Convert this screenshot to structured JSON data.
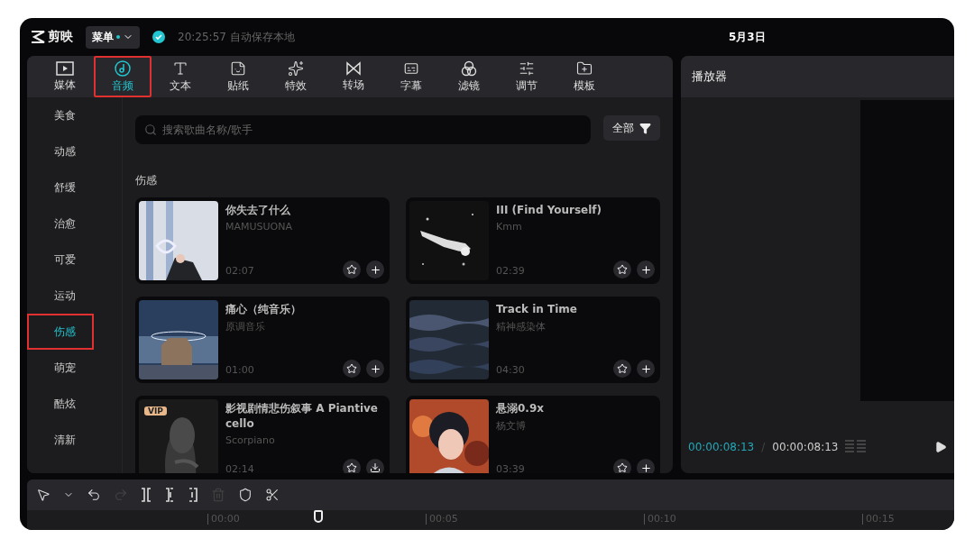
{
  "app": {
    "name": "剪映",
    "menu": "菜单",
    "menu_dot": true,
    "save_status": "20:25:57 自动保存本地",
    "date": "5月3日"
  },
  "tabs": [
    {
      "label": "媒体",
      "selected": false,
      "annotated": false
    },
    {
      "label": "音频",
      "selected": true,
      "annotated": true
    },
    {
      "label": "文本",
      "selected": false,
      "annotated": false
    },
    {
      "label": "贴纸",
      "selected": false,
      "annotated": false
    },
    {
      "label": "特效",
      "selected": false,
      "annotated": false
    },
    {
      "label": "转场",
      "selected": false,
      "annotated": false
    },
    {
      "label": "字幕",
      "selected": false,
      "annotated": false
    },
    {
      "label": "滤镜",
      "selected": false,
      "annotated": false
    },
    {
      "label": "调节",
      "selected": false,
      "annotated": false
    },
    {
      "label": "模板",
      "selected": false,
      "annotated": false
    }
  ],
  "categories": [
    {
      "label": "美食",
      "selected": false,
      "annotated": false
    },
    {
      "label": "动感",
      "selected": false,
      "annotated": false
    },
    {
      "label": "舒缓",
      "selected": false,
      "annotated": false
    },
    {
      "label": "治愈",
      "selected": false,
      "annotated": false
    },
    {
      "label": "可爱",
      "selected": false,
      "annotated": false
    },
    {
      "label": "运动",
      "selected": false,
      "annotated": false
    },
    {
      "label": "伤感",
      "selected": true,
      "annotated": true
    },
    {
      "label": "萌宠",
      "selected": false,
      "annotated": false
    },
    {
      "label": "酷炫",
      "selected": false,
      "annotated": false
    },
    {
      "label": "清新",
      "selected": false,
      "annotated": false
    }
  ],
  "search": {
    "placeholder": "搜索歌曲名称/歌手",
    "filter": "全部"
  },
  "section_title": "伤感",
  "songs": [
    {
      "title": "你失去了什么",
      "artist": "MAMUSUONA",
      "duration": "02:07",
      "kind": "add"
    },
    {
      "title": "III (Find Yourself)",
      "artist": "Kmm",
      "duration": "02:39",
      "kind": "add"
    },
    {
      "title": "痛心（纯音乐）",
      "artist": "原调音乐",
      "duration": "01:00",
      "kind": "add"
    },
    {
      "title": "Track in Time",
      "artist": "精神感染体",
      "duration": "04:30",
      "kind": "add"
    },
    {
      "title": "影视剧情悲伤叙事  A Piantive cello",
      "artist": "Scorpiano",
      "duration": "02:14",
      "kind": "download",
      "badge": "VIP"
    },
    {
      "title": "悬溺0.9x",
      "artist": "杨文博",
      "duration": "03:39",
      "kind": "add"
    }
  ],
  "player": {
    "title": "播放器",
    "current_time": "00:00:08:13",
    "separator": "/",
    "total_time": "00:00:08:13"
  },
  "toolbar": [
    {
      "disabled": false
    },
    {
      "disabled": false
    },
    {
      "disabled": false
    },
    {
      "disabled": true
    },
    {
      "disabled": false
    },
    {
      "disabled": false
    },
    {
      "disabled": false
    },
    {
      "disabled": true
    },
    {
      "disabled": false
    },
    {
      "disabled": false
    }
  ],
  "timeline": {
    "ticks": [
      "00:00",
      "00:05",
      "00:10",
      "00:15"
    ]
  }
}
